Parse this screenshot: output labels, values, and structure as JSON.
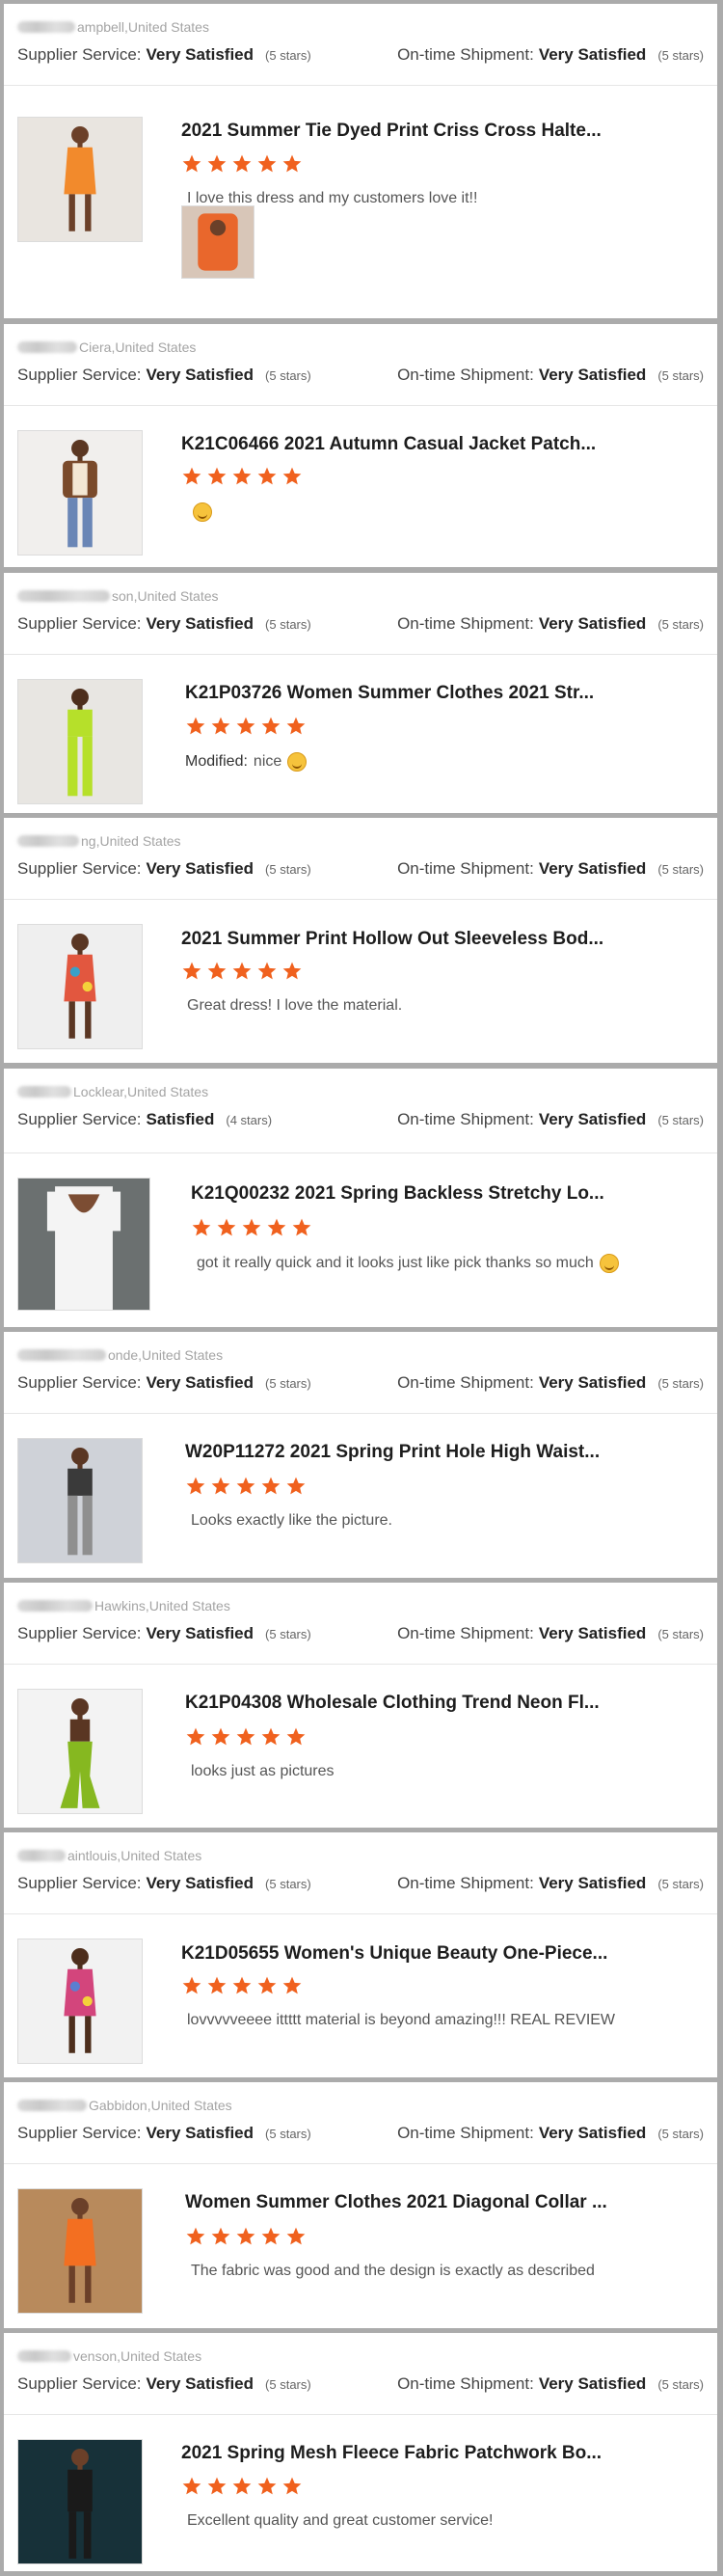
{
  "labels": {
    "supplier_service": "Supplier Service:",
    "ontime_shipment": "On-time Shipment:"
  },
  "colors": {
    "star": "#f0611e",
    "separator": "#ababab",
    "title": "#1d1d1d"
  },
  "reviews": [
    {
      "reviewer": "ampbell,United States",
      "supplier_rating": "Very Satisfied",
      "supplier_stars": "(5 stars)",
      "shipment_rating": "Very Satisfied",
      "shipment_stars": "(5 stars)",
      "product_title": "2021 Summer Tie Dyed Print Criss Cross Halte...",
      "stars": 5,
      "comment_prefix": "",
      "comment": "I love this dress and my customers love it!!",
      "emoji": "",
      "thumb_icon": "orange-halter-dress",
      "extra_photo": "orange-halter-dress-detail"
    },
    {
      "reviewer": "Ciera,United States",
      "supplier_rating": "Very Satisfied",
      "supplier_stars": "(5 stars)",
      "shipment_rating": "Very Satisfied",
      "shipment_stars": "(5 stars)",
      "product_title": "K21C06466 2021 Autumn Casual Jacket Patch...",
      "stars": 5,
      "comment_prefix": "",
      "comment": "",
      "emoji": "smiling-face",
      "thumb_icon": "brown-jacket-outfit"
    },
    {
      "reviewer": "son,United States",
      "supplier_rating": "Very Satisfied",
      "supplier_stars": "(5 stars)",
      "shipment_rating": "Very Satisfied",
      "shipment_stars": "(5 stars)",
      "product_title": "K21P03726 Women Summer Clothes 2021 Str...",
      "stars": 5,
      "comment_prefix": "Modified:",
      "comment": "nice",
      "emoji": "smiling-face",
      "thumb_icon": "lime-green-set"
    },
    {
      "reviewer": "ng,United States",
      "supplier_rating": "Very Satisfied",
      "supplier_stars": "(5 stars)",
      "shipment_rating": "Very Satisfied",
      "shipment_stars": "(5 stars)",
      "product_title": "2021 Summer Print Hollow Out Sleeveless Bod...",
      "stars": 5,
      "comment_prefix": "",
      "comment": "Great dress! I love the material.",
      "emoji": "",
      "thumb_icon": "print-bodycon-dress"
    },
    {
      "reviewer": "Locklear,United States",
      "supplier_rating": "Satisfied",
      "supplier_stars": "(4 stars)",
      "shipment_rating": "Very Satisfied",
      "shipment_stars": "(5 stars)",
      "product_title": "K21Q00232 2021 Spring Backless Stretchy Lo...",
      "stars": 5,
      "comment_prefix": "",
      "comment": "got it really quick and it looks just like pick thanks so much",
      "emoji": "smiling-face",
      "thumb_icon": "white-backless-jumpsuit"
    },
    {
      "reviewer": "onde,United States",
      "supplier_rating": "Very Satisfied",
      "supplier_stars": "(5 stars)",
      "shipment_rating": "Very Satisfied",
      "shipment_stars": "(5 stars)",
      "product_title": "W20P11272 2021 Spring Print Hole High Waist...",
      "stars": 5,
      "comment_prefix": "",
      "comment": "Looks exactly like the picture.",
      "emoji": "",
      "thumb_icon": "print-pants-outfit"
    },
    {
      "reviewer": "Hawkins,United States",
      "supplier_rating": "Very Satisfied",
      "supplier_stars": "(5 stars)",
      "shipment_rating": "Very Satisfied",
      "shipment_stars": "(5 stars)",
      "product_title": "K21P04308 Wholesale Clothing Trend Neon Fl...",
      "stars": 5,
      "comment_prefix": "",
      "comment": "looks just as pictures",
      "emoji": "",
      "thumb_icon": "neon-flare-pants"
    },
    {
      "reviewer": "aintlouis,United States",
      "supplier_rating": "Very Satisfied",
      "supplier_stars": "(5 stars)",
      "shipment_rating": "Very Satisfied",
      "shipment_stars": "(5 stars)",
      "product_title": "K21D05655 Women's Unique Beauty One-Piece...",
      "stars": 5,
      "comment_prefix": "",
      "comment": "lovvvvveeee ittttt material is beyond amazing!!! REAL REVIEW",
      "emoji": "",
      "thumb_icon": "print-one-piece-dress"
    },
    {
      "reviewer": "Gabbidon,United States",
      "supplier_rating": "Very Satisfied",
      "supplier_stars": "(5 stars)",
      "shipment_rating": "Very Satisfied",
      "shipment_stars": "(5 stars)",
      "product_title": "Women Summer Clothes 2021 Diagonal Collar ...",
      "stars": 5,
      "comment_prefix": "",
      "comment": "The fabric was good and the design is exactly as described",
      "emoji": "",
      "thumb_icon": "orange-diagonal-dress"
    },
    {
      "reviewer": "venson,United States",
      "supplier_rating": "Very Satisfied",
      "supplier_stars": "(5 stars)",
      "shipment_rating": "Very Satisfied",
      "shipment_stars": "(5 stars)",
      "product_title": "2021 Spring Mesh Fleece Fabric Patchwork Bo...",
      "stars": 5,
      "comment_prefix": "",
      "comment": "Excellent quality and great customer service!",
      "emoji": "",
      "thumb_icon": "black-mesh-bodysuit"
    }
  ]
}
